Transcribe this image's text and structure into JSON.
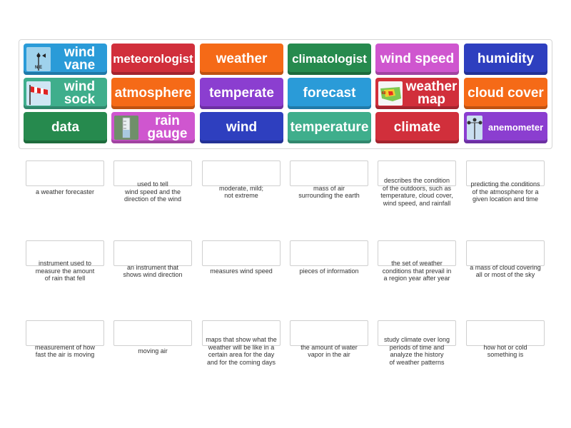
{
  "colors": {
    "blue": "#2a9bd8",
    "red": "#d12f3b",
    "orange": "#f56a17",
    "green": "#268a4e",
    "pink": "#cf56cf",
    "navy": "#2e3fbf",
    "purple": "#8b3ed0",
    "teal": "#3fae8c"
  },
  "tiles": [
    {
      "label": "wind\nvane",
      "color": "blue",
      "icon": "wind-vane-photo"
    },
    {
      "label": "meteorologist",
      "color": "red"
    },
    {
      "label": "weather",
      "color": "orange"
    },
    {
      "label": "climatologist",
      "color": "green"
    },
    {
      "label": "wind speed",
      "color": "pink"
    },
    {
      "label": "humidity",
      "color": "navy"
    },
    {
      "label": "wind\nsock",
      "color": "teal",
      "icon": "wind-sock-photo"
    },
    {
      "label": "atmosphere",
      "color": "orange"
    },
    {
      "label": "temperate",
      "color": "purple"
    },
    {
      "label": "forecast",
      "color": "blue"
    },
    {
      "label": "weather\nmap",
      "color": "red",
      "icon": "weather-map-photo"
    },
    {
      "label": "cloud cover",
      "color": "orange"
    },
    {
      "label": "data",
      "color": "green"
    },
    {
      "label": "rain\ngauge",
      "color": "pink",
      "icon": "rain-gauge-photo"
    },
    {
      "label": "wind",
      "color": "navy"
    },
    {
      "label": "temperature",
      "color": "teal"
    },
    {
      "label": "climate",
      "color": "red"
    },
    {
      "label": "anemometer",
      "color": "purple",
      "icon": "anemometer-photo"
    }
  ],
  "clues": [
    "a weather forecaster",
    "used to tell\nwind speed and the\ndirection of the wind",
    "moderate, mild;\nnot extreme",
    "mass of air\nsurrounding the earth",
    "describes the condition\nof the outdoors, such as\ntemperature, cloud cover,\nwind speed, and rainfall",
    "predicting the conditions\nof the atmosphere for a\ngiven location and time",
    "instrument used to\nmeasure the amount\nof rain that fell",
    "an instrument that\nshows wind direction",
    "measures wind speed",
    "pieces of information",
    "the set of weather\nconditions that prevail in\na region year after year",
    "a mass of cloud covering\nall or most of the sky",
    "measurement of how\nfast the air is moving",
    "moving air",
    "maps that show what the\nweather will be like in a\ncertain area for the day\nand for the coming days",
    "the amount of water\nvapor in the air",
    "study climate over long\nperiods of time and\nanalyze the history\nof weather patterns",
    "how hot or cold\nsomething is"
  ]
}
